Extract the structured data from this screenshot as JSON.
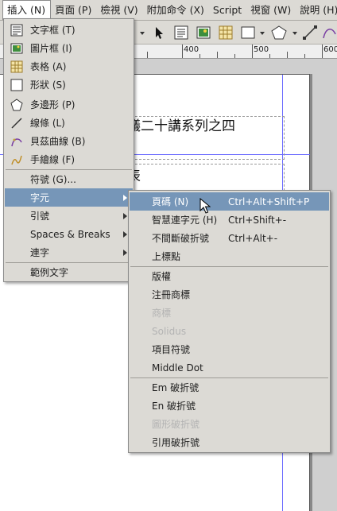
{
  "menubar": {
    "items": [
      "插入 (N)",
      "頁面 (P)",
      "檢視 (V)",
      "附加命令 (X)",
      "Script",
      "視窗 (W)",
      "說明 (H)"
    ]
  },
  "ruler": {
    "labels": [
      "400",
      "500",
      "600"
    ]
  },
  "document": {
    "heading1": "議二十講系列之四",
    "heading2": "表"
  },
  "insert_menu": {
    "items": [
      {
        "label": "文字框 (T)",
        "icon": "text-frame-icon"
      },
      {
        "label": "圖片框 (I)",
        "icon": "image-frame-icon"
      },
      {
        "label": "表格 (A)",
        "icon": "table-icon"
      },
      {
        "label": "形狀 (S)",
        "icon": "shape-icon"
      },
      {
        "label": "多邊形 (P)",
        "icon": "polygon-icon"
      },
      {
        "label": "線條 (L)",
        "icon": "line-icon"
      },
      {
        "label": "貝茲曲線 (B)",
        "icon": "bezier-icon"
      },
      {
        "label": "手繪線 (F)",
        "icon": "freehand-icon"
      },
      {
        "label": "符號 (G)..."
      },
      {
        "label": "字元"
      },
      {
        "label": "引號"
      },
      {
        "label": "Spaces & Breaks"
      },
      {
        "label": "連字"
      },
      {
        "label": "範例文字"
      }
    ]
  },
  "char_submenu": {
    "items": [
      {
        "label": "頁碼 (N)",
        "shortcut": "Ctrl+Alt+Shift+P"
      },
      {
        "label": "智慧連字元 (H)",
        "shortcut": "Ctrl+Shift+-"
      },
      {
        "label": "不間斷破折號",
        "shortcut": "Ctrl+Alt+-"
      },
      {
        "label": "上標點",
        "shortcut": ""
      },
      {
        "label": "版權",
        "shortcut": ""
      },
      {
        "label": "注冊商標",
        "shortcut": ""
      },
      {
        "label": "商標",
        "shortcut": ""
      },
      {
        "label": "Solidus",
        "shortcut": ""
      },
      {
        "label": "項目符號",
        "shortcut": ""
      },
      {
        "label": "Middle Dot",
        "shortcut": ""
      },
      {
        "label": "Em 破折號",
        "shortcut": ""
      },
      {
        "label": "En 破折號",
        "shortcut": ""
      },
      {
        "label": "圖形破折號",
        "shortcut": ""
      },
      {
        "label": "引用破折號",
        "shortcut": ""
      }
    ]
  },
  "colors": {
    "highlight": "#7696b8",
    "menu_bg": "#dcdad5",
    "disabled": "#b3b3b3"
  }
}
